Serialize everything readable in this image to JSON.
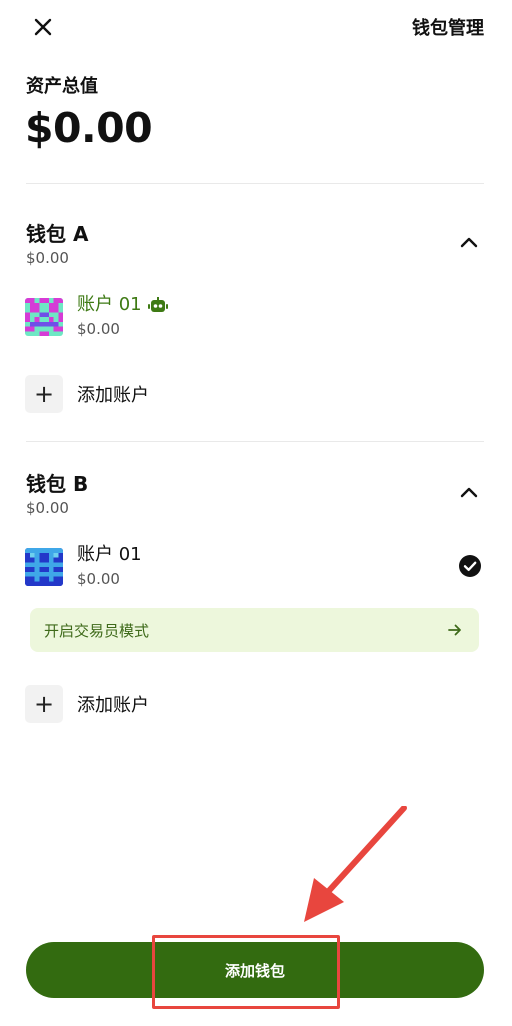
{
  "header": {
    "manage_label": "钱包管理"
  },
  "summary": {
    "total_label": "资产总值",
    "total_value": "$0.00"
  },
  "wallets": [
    {
      "title": "钱包 A",
      "total": "$0.00",
      "accounts": [
        {
          "name": "账户 01",
          "balance": "$0.00"
        }
      ],
      "add_account_label": "添加账户"
    },
    {
      "title": "钱包 B",
      "total": "$0.00",
      "accounts": [
        {
          "name": "账户 01",
          "balance": "$0.00"
        }
      ],
      "trader_mode_label": "开启交易员模式",
      "add_account_label": "添加账户"
    }
  ],
  "footer": {
    "add_wallet_label": "添加钱包"
  },
  "colors": {
    "brand_green": "#336b10",
    "active_account_name": "#3e7a14",
    "banner_bg": "#edf7dc",
    "annotation_red": "#e8463e"
  },
  "icons": [
    "close-icon",
    "robot-icon",
    "chevron-up-icon",
    "check-circle-icon",
    "plus-icon",
    "arrow-right-icon"
  ]
}
